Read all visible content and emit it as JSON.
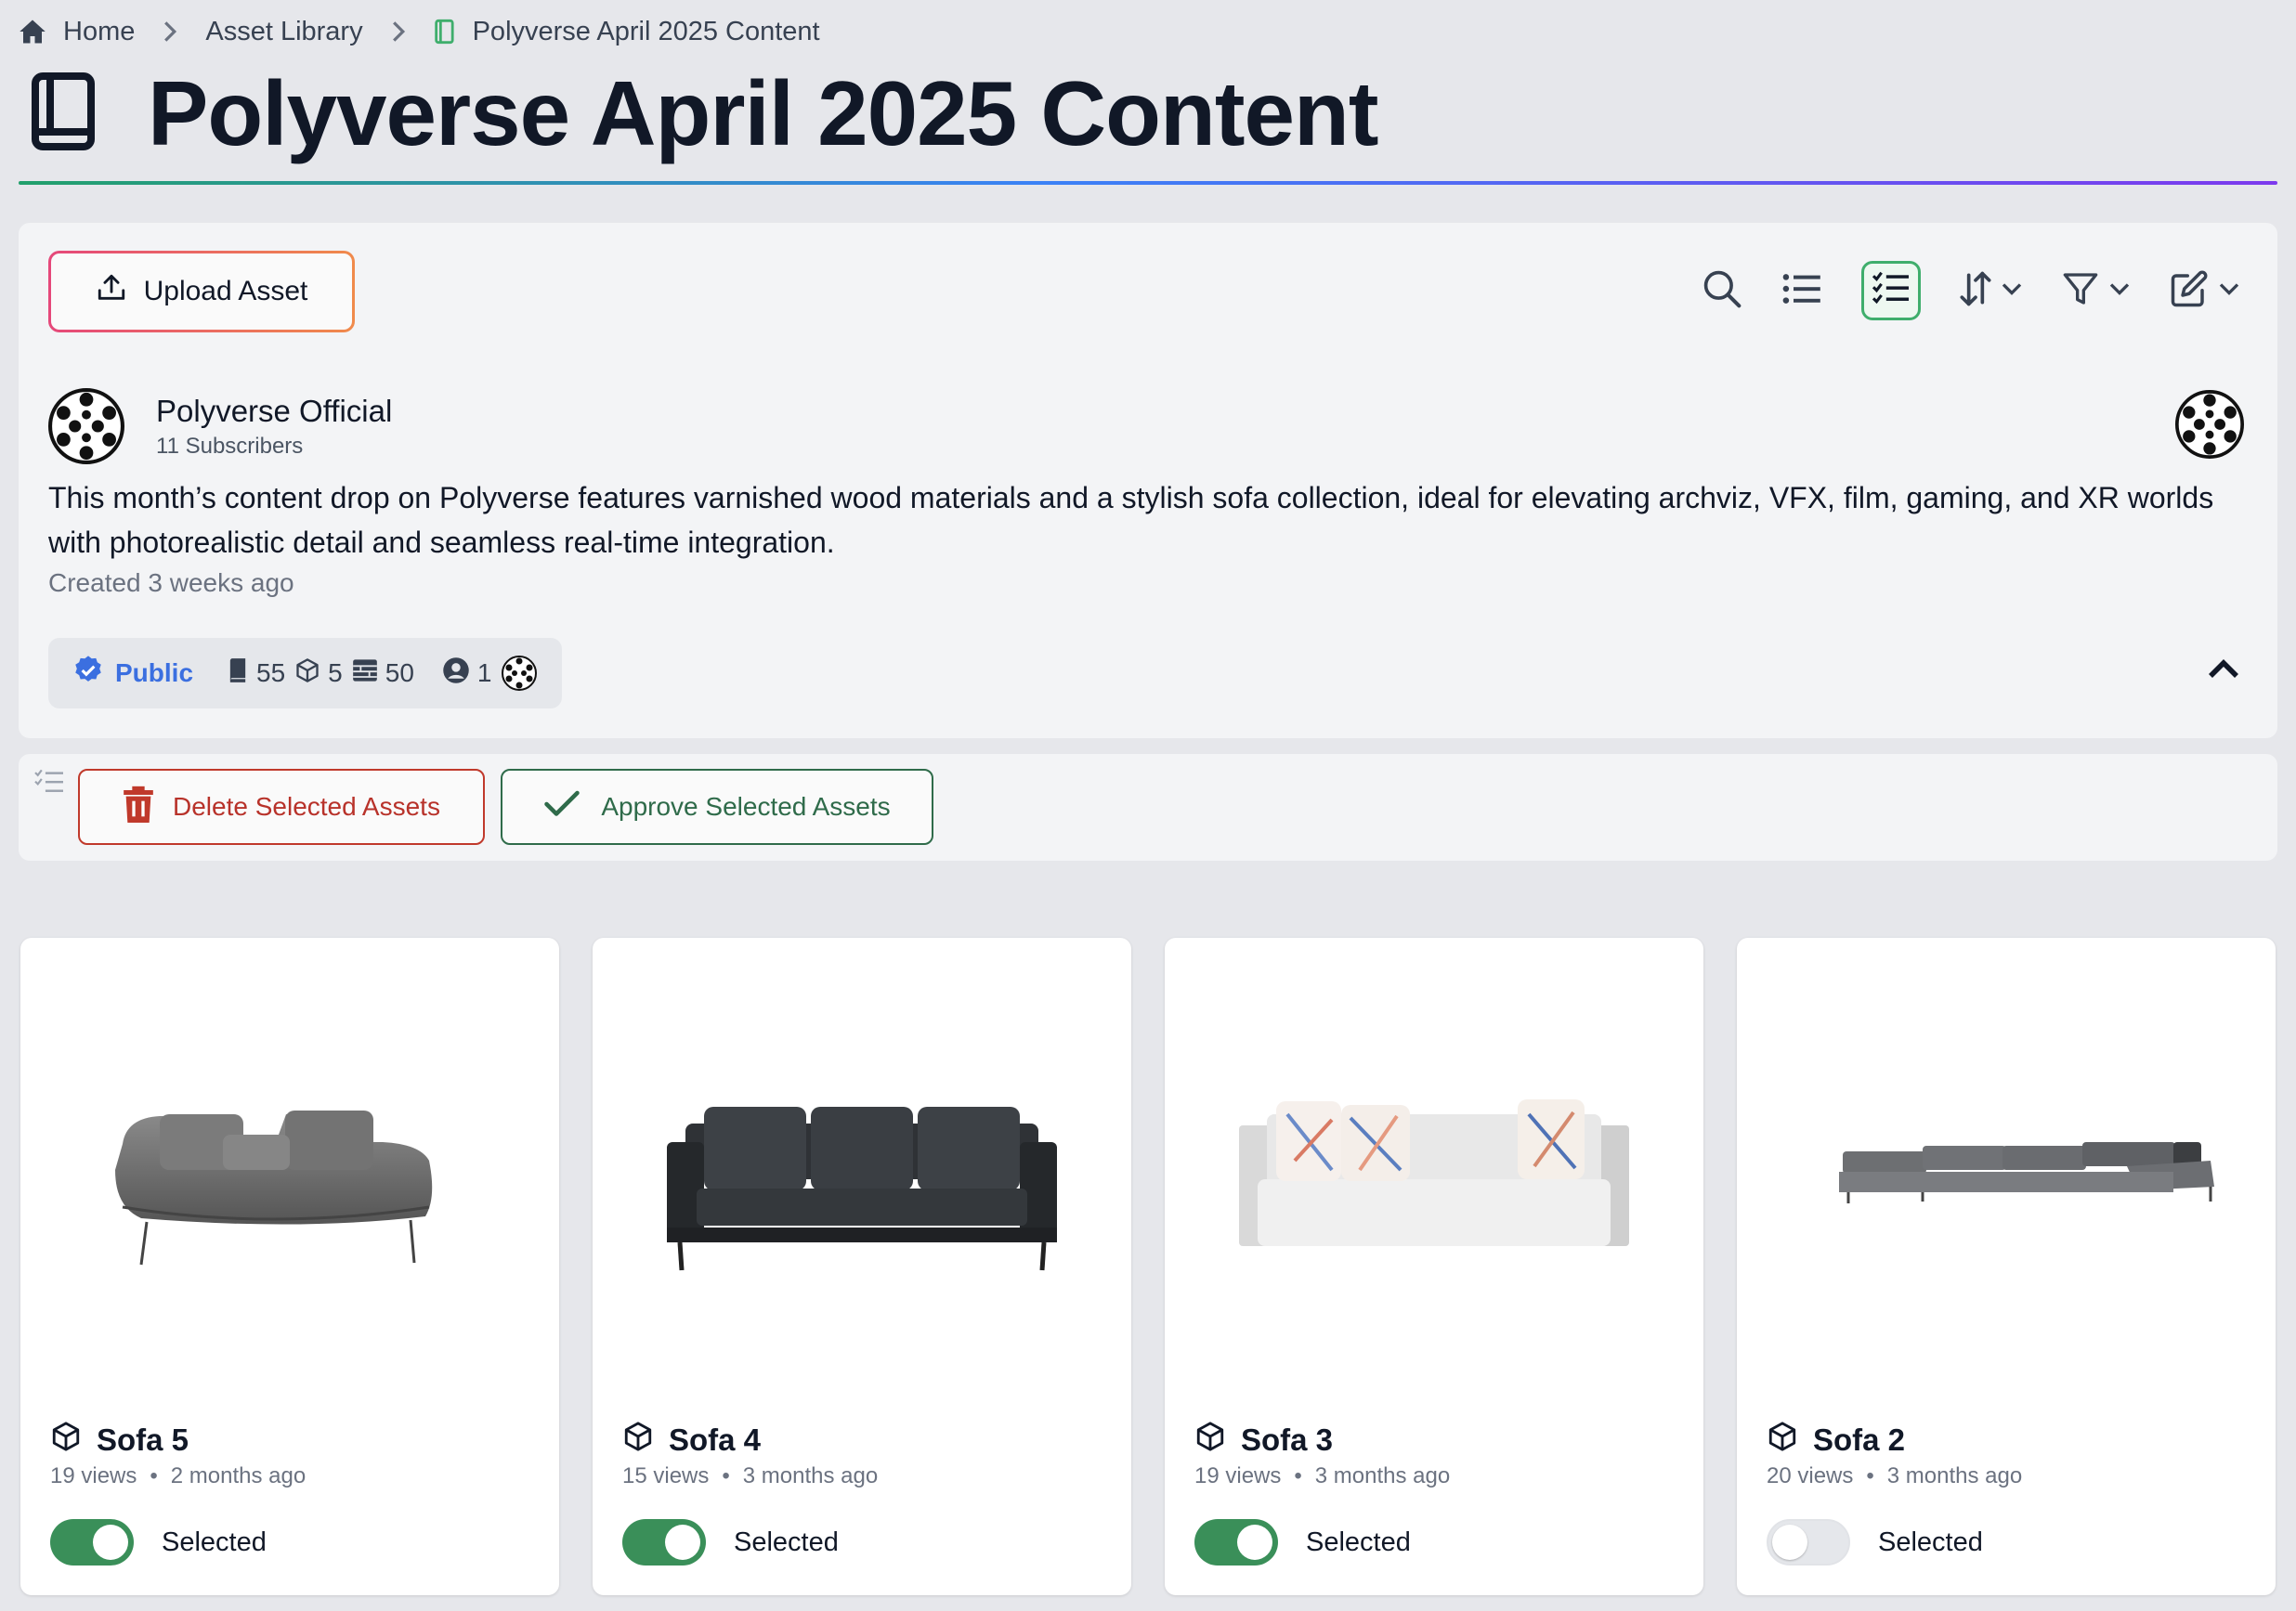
{
  "breadcrumb": {
    "home": "Home",
    "library": "Asset Library",
    "current": "Polyverse April 2025 Content"
  },
  "page": {
    "title": "Polyverse April 2025 Content"
  },
  "toolbar": {
    "upload_label": "Upload Asset",
    "icons": [
      "search-icon",
      "list-view-icon",
      "select-mode-icon",
      "sort-icon",
      "filter-icon",
      "edit-icon"
    ]
  },
  "channel": {
    "name": "Polyverse Official",
    "subscribers": "11 Subscribers",
    "description": "This month’s content drop on Polyverse features varnished wood materials and a stylish sofa collection, ideal for elevating archviz, VFX, film, gaming, and XR worlds with photorealistic detail and seamless real-time integration.",
    "created": "Created 3 weeks ago"
  },
  "stats": {
    "visibility": "Public",
    "collections": "55",
    "models": "5",
    "materials": "50",
    "members": "1"
  },
  "actions": {
    "delete_label": "Delete Selected Assets",
    "approve_label": "Approve Selected Assets"
  },
  "colors": {
    "accent_green": "#3a8f59",
    "danger_red": "#b8322a",
    "public_blue": "#3b6fe0"
  },
  "assets": [
    {
      "title": "Sofa 5",
      "views": "19 views",
      "age": "2 months ago",
      "toggle_label": "Selected",
      "selected": true
    },
    {
      "title": "Sofa 4",
      "views": "15 views",
      "age": "3 months ago",
      "toggle_label": "Selected",
      "selected": true
    },
    {
      "title": "Sofa 3",
      "views": "19 views",
      "age": "3 months ago",
      "toggle_label": "Selected",
      "selected": true
    },
    {
      "title": "Sofa 2",
      "views": "20 views",
      "age": "3 months ago",
      "toggle_label": "Selected",
      "selected": false
    }
  ]
}
